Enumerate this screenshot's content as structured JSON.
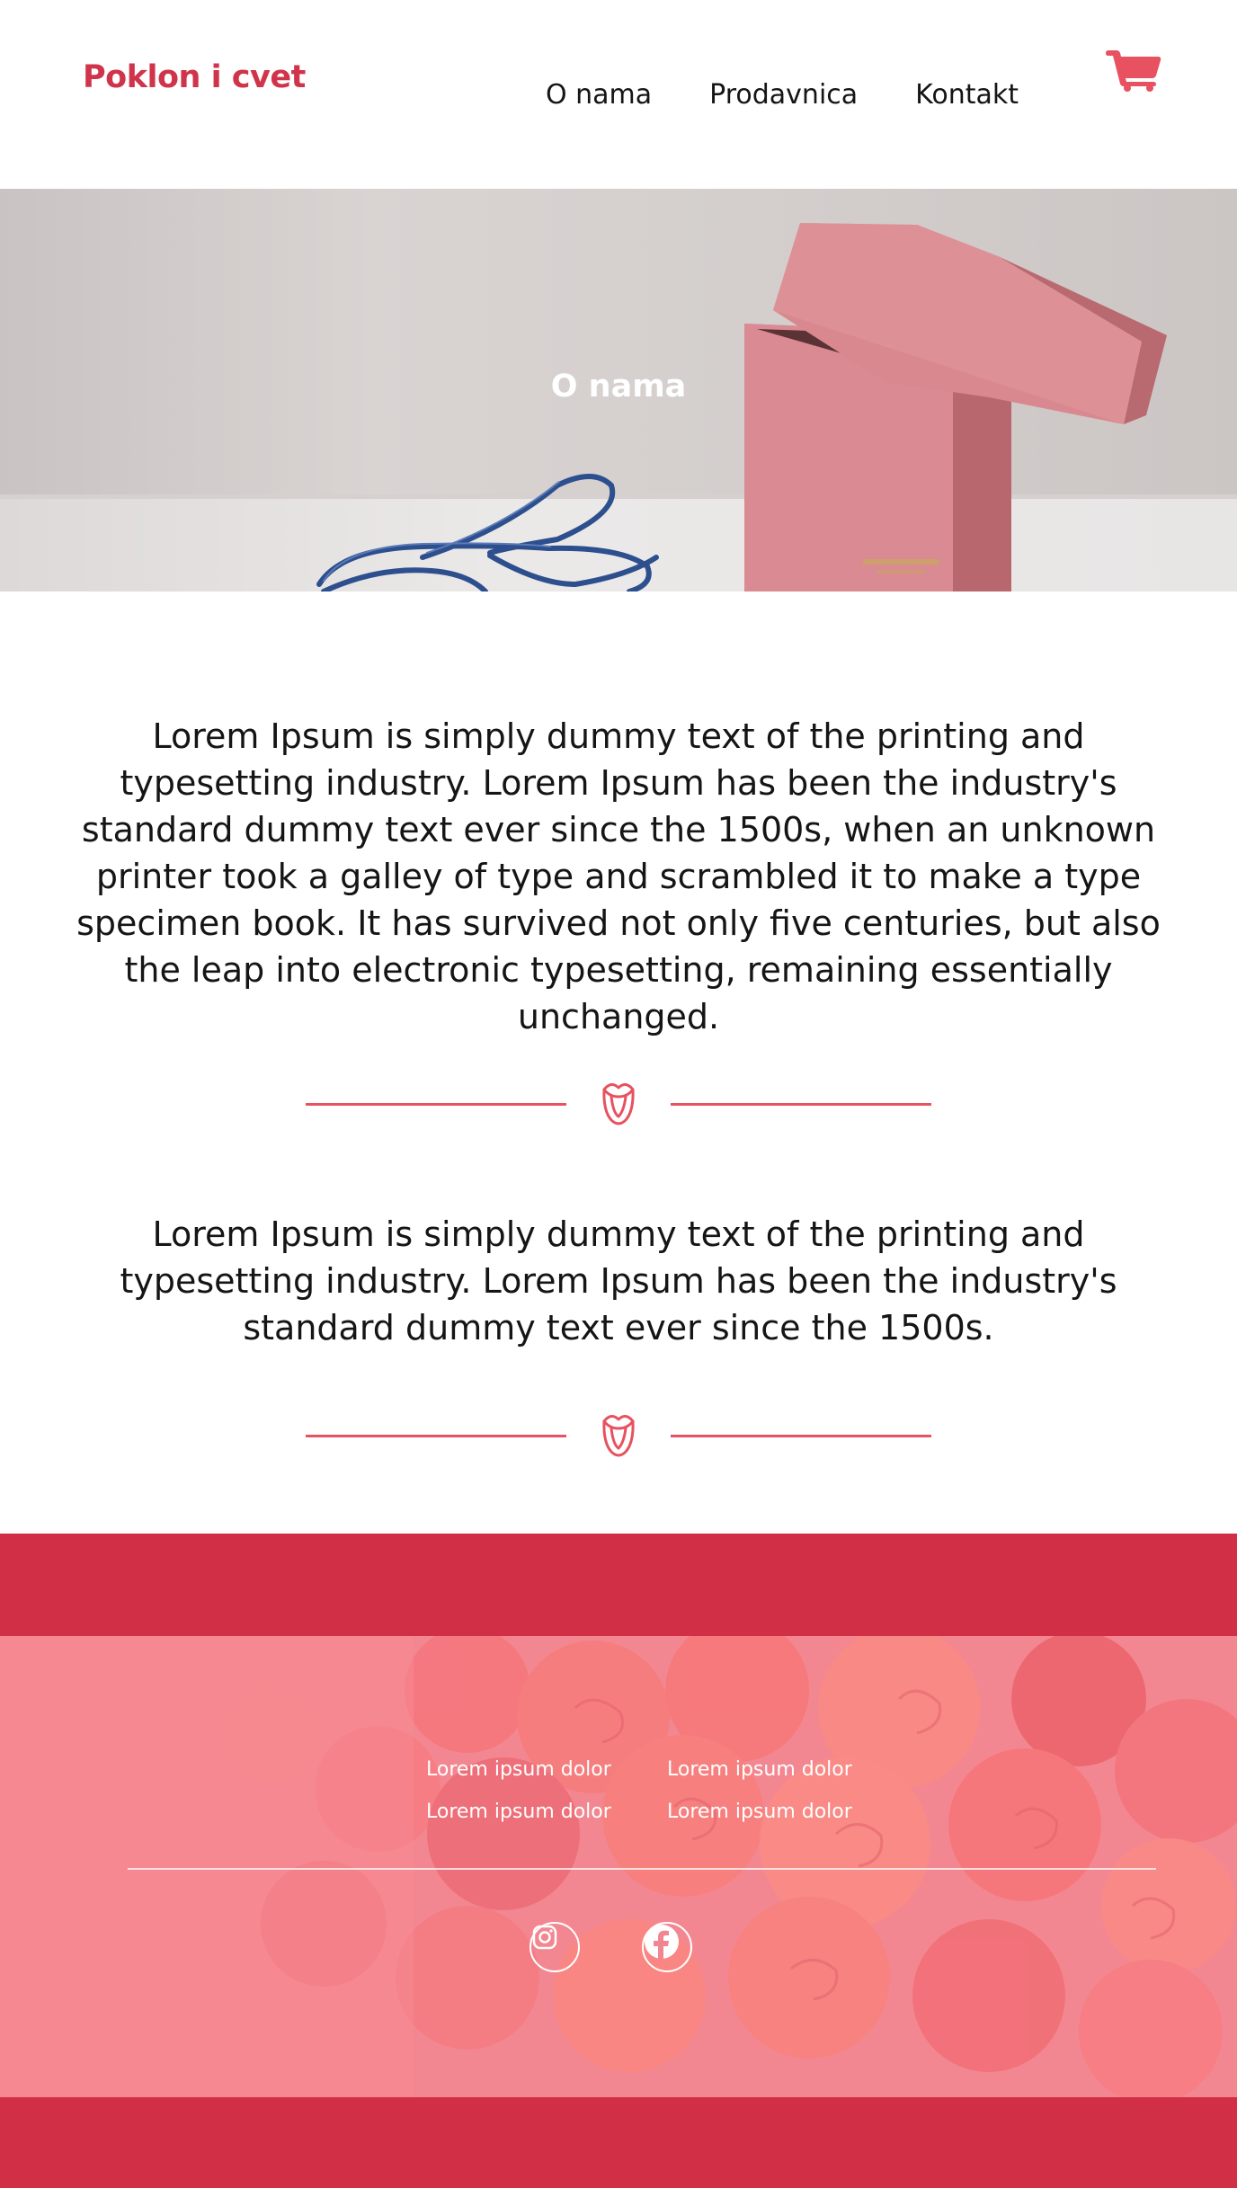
{
  "header": {
    "logo": "Poklon i cvet",
    "nav": [
      "O nama",
      "Prodavnica",
      "Kontakt"
    ],
    "cart_icon": "cart-icon"
  },
  "hero": {
    "title": "O nama"
  },
  "content": {
    "paragraph1": "Lorem Ipsum is simply dummy text of the printing and typesetting industry. Lorem Ipsum has been the industry's standard dummy text ever since the 1500s, when an unknown printer took a galley of type and scrambled it to make a type specimen book. It has survived not only five centuries, but also the leap into electronic typesetting, remaining essentially unchanged.",
    "paragraph2": "Lorem Ipsum is simply dummy text of the printing and typesetting industry. Lorem Ipsum has been the industry's standard dummy text ever since the 1500s.",
    "divider_icon": "rose-icon"
  },
  "footer": {
    "links": [
      "Lorem ipsum dolor",
      "Lorem ipsum dolor",
      "Lorem ipsum dolor",
      "Lorem ipsum dolor"
    ],
    "social_icons": [
      "instagram-icon",
      "facebook-icon"
    ]
  },
  "colors": {
    "accent": "#d0344a",
    "divider": "#e8515f",
    "footer_band": "#d12f45",
    "footer_image_tint": "#f0818b"
  }
}
